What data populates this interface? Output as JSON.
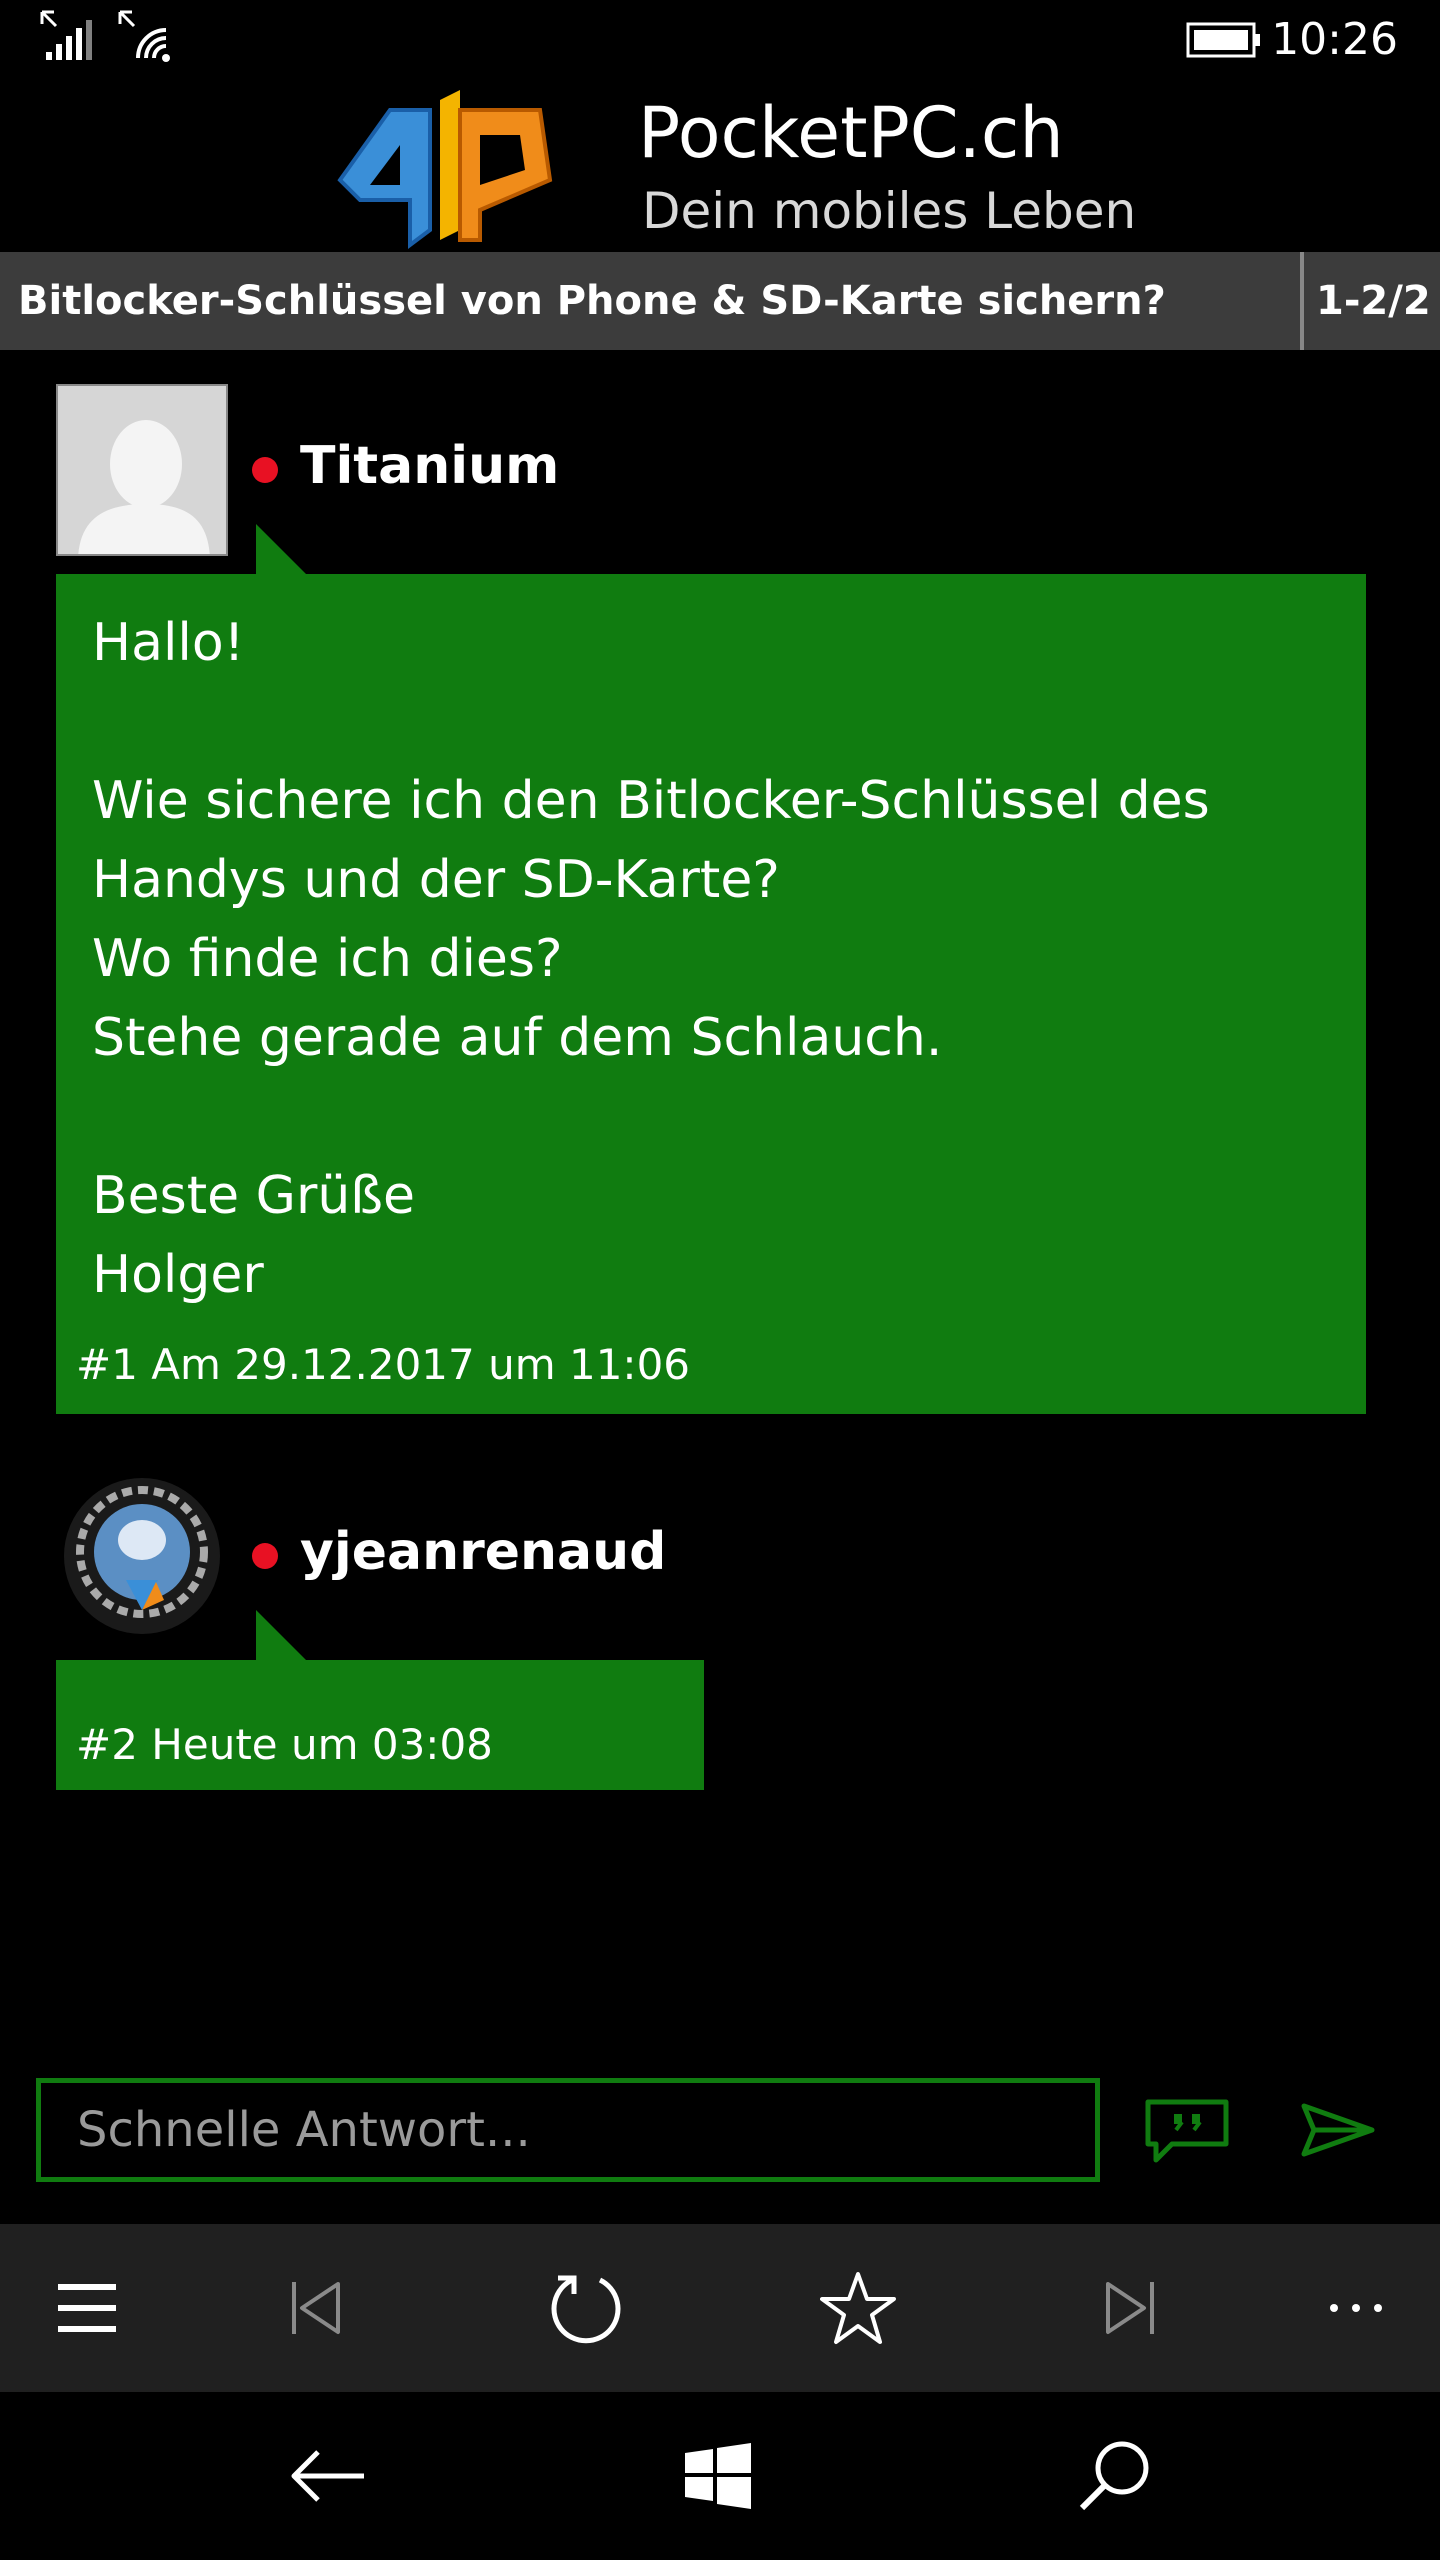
{
  "status": {
    "time": "10:26"
  },
  "header": {
    "site_title": "PocketPC.ch",
    "site_subtitle": "Dein mobiles Leben"
  },
  "thread": {
    "title": "Bitlocker-Schlüssel von Phone & SD-Karte sichern?",
    "pages": "1-2/2"
  },
  "posts": [
    {
      "username": "Titanium",
      "body": "Hallo!\n\nWie sichere ich den Bitlocker-Schlüssel des Handys und der SD-Karte?\nWo finde ich dies?\nStehe gerade auf dem Schlauch.\n\nBeste Grüße\nHolger",
      "number": "#1",
      "date": "Am 29.12.2017 um 11:06"
    },
    {
      "username": "yjeanrenaud",
      "body": "",
      "number": "#2",
      "date": "Heute um 03:08"
    }
  ],
  "reply": {
    "placeholder": "Schnelle Antwort..."
  },
  "appbar": {
    "icons": [
      "menu-icon",
      "first-page-icon",
      "refresh-icon",
      "star-icon",
      "last-page-icon",
      "more-icon"
    ]
  },
  "navbar": {
    "icons": [
      "back-icon",
      "windows-icon",
      "search-icon"
    ]
  },
  "colors": {
    "accent": "#107c10",
    "online": "#e81123",
    "title_bar": "#3c3c3c",
    "appbar": "#202020"
  }
}
